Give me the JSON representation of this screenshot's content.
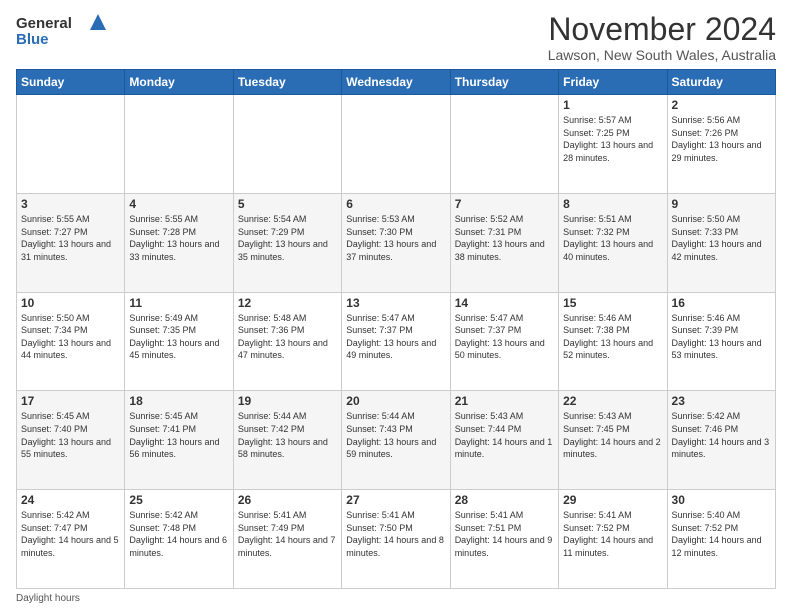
{
  "header": {
    "logo_general": "General",
    "logo_blue": "Blue",
    "main_title": "November 2024",
    "subtitle": "Lawson, New South Wales, Australia"
  },
  "days_of_week": [
    "Sunday",
    "Monday",
    "Tuesday",
    "Wednesday",
    "Thursday",
    "Friday",
    "Saturday"
  ],
  "weeks": [
    [
      {
        "day": "",
        "info": ""
      },
      {
        "day": "",
        "info": ""
      },
      {
        "day": "",
        "info": ""
      },
      {
        "day": "",
        "info": ""
      },
      {
        "day": "",
        "info": ""
      },
      {
        "day": "1",
        "info": "Sunrise: 5:57 AM\nSunset: 7:25 PM\nDaylight: 13 hours\nand 28 minutes."
      },
      {
        "day": "2",
        "info": "Sunrise: 5:56 AM\nSunset: 7:26 PM\nDaylight: 13 hours\nand 29 minutes."
      }
    ],
    [
      {
        "day": "3",
        "info": "Sunrise: 5:55 AM\nSunset: 7:27 PM\nDaylight: 13 hours\nand 31 minutes."
      },
      {
        "day": "4",
        "info": "Sunrise: 5:55 AM\nSunset: 7:28 PM\nDaylight: 13 hours\nand 33 minutes."
      },
      {
        "day": "5",
        "info": "Sunrise: 5:54 AM\nSunset: 7:29 PM\nDaylight: 13 hours\nand 35 minutes."
      },
      {
        "day": "6",
        "info": "Sunrise: 5:53 AM\nSunset: 7:30 PM\nDaylight: 13 hours\nand 37 minutes."
      },
      {
        "day": "7",
        "info": "Sunrise: 5:52 AM\nSunset: 7:31 PM\nDaylight: 13 hours\nand 38 minutes."
      },
      {
        "day": "8",
        "info": "Sunrise: 5:51 AM\nSunset: 7:32 PM\nDaylight: 13 hours\nand 40 minutes."
      },
      {
        "day": "9",
        "info": "Sunrise: 5:50 AM\nSunset: 7:33 PM\nDaylight: 13 hours\nand 42 minutes."
      }
    ],
    [
      {
        "day": "10",
        "info": "Sunrise: 5:50 AM\nSunset: 7:34 PM\nDaylight: 13 hours\nand 44 minutes."
      },
      {
        "day": "11",
        "info": "Sunrise: 5:49 AM\nSunset: 7:35 PM\nDaylight: 13 hours\nand 45 minutes."
      },
      {
        "day": "12",
        "info": "Sunrise: 5:48 AM\nSunset: 7:36 PM\nDaylight: 13 hours\nand 47 minutes."
      },
      {
        "day": "13",
        "info": "Sunrise: 5:47 AM\nSunset: 7:37 PM\nDaylight: 13 hours\nand 49 minutes."
      },
      {
        "day": "14",
        "info": "Sunrise: 5:47 AM\nSunset: 7:37 PM\nDaylight: 13 hours\nand 50 minutes."
      },
      {
        "day": "15",
        "info": "Sunrise: 5:46 AM\nSunset: 7:38 PM\nDaylight: 13 hours\nand 52 minutes."
      },
      {
        "day": "16",
        "info": "Sunrise: 5:46 AM\nSunset: 7:39 PM\nDaylight: 13 hours\nand 53 minutes."
      }
    ],
    [
      {
        "day": "17",
        "info": "Sunrise: 5:45 AM\nSunset: 7:40 PM\nDaylight: 13 hours\nand 55 minutes."
      },
      {
        "day": "18",
        "info": "Sunrise: 5:45 AM\nSunset: 7:41 PM\nDaylight: 13 hours\nand 56 minutes."
      },
      {
        "day": "19",
        "info": "Sunrise: 5:44 AM\nSunset: 7:42 PM\nDaylight: 13 hours\nand 58 minutes."
      },
      {
        "day": "20",
        "info": "Sunrise: 5:44 AM\nSunset: 7:43 PM\nDaylight: 13 hours\nand 59 minutes."
      },
      {
        "day": "21",
        "info": "Sunrise: 5:43 AM\nSunset: 7:44 PM\nDaylight: 14 hours\nand 1 minute."
      },
      {
        "day": "22",
        "info": "Sunrise: 5:43 AM\nSunset: 7:45 PM\nDaylight: 14 hours\nand 2 minutes."
      },
      {
        "day": "23",
        "info": "Sunrise: 5:42 AM\nSunset: 7:46 PM\nDaylight: 14 hours\nand 3 minutes."
      }
    ],
    [
      {
        "day": "24",
        "info": "Sunrise: 5:42 AM\nSunset: 7:47 PM\nDaylight: 14 hours\nand 5 minutes."
      },
      {
        "day": "25",
        "info": "Sunrise: 5:42 AM\nSunset: 7:48 PM\nDaylight: 14 hours\nand 6 minutes."
      },
      {
        "day": "26",
        "info": "Sunrise: 5:41 AM\nSunset: 7:49 PM\nDaylight: 14 hours\nand 7 minutes."
      },
      {
        "day": "27",
        "info": "Sunrise: 5:41 AM\nSunset: 7:50 PM\nDaylight: 14 hours\nand 8 minutes."
      },
      {
        "day": "28",
        "info": "Sunrise: 5:41 AM\nSunset: 7:51 PM\nDaylight: 14 hours\nand 9 minutes."
      },
      {
        "day": "29",
        "info": "Sunrise: 5:41 AM\nSunset: 7:52 PM\nDaylight: 14 hours\nand 11 minutes."
      },
      {
        "day": "30",
        "info": "Sunrise: 5:40 AM\nSunset: 7:52 PM\nDaylight: 14 hours\nand 12 minutes."
      }
    ]
  ],
  "footer": {
    "daylight_label": "Daylight hours"
  }
}
